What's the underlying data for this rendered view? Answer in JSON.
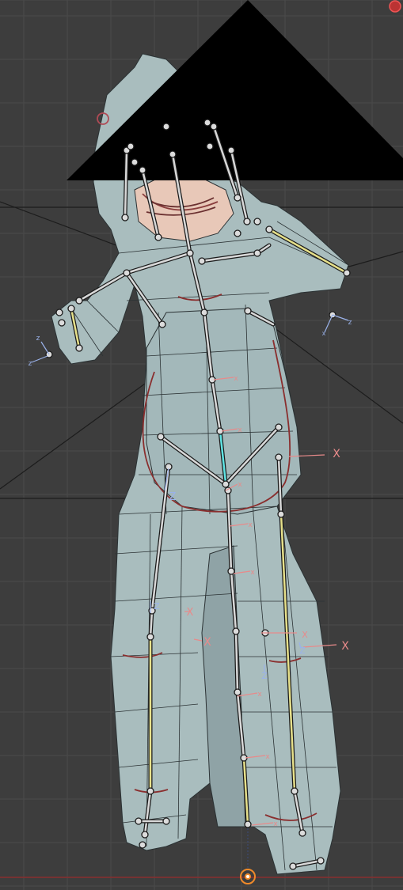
{
  "viewport": {
    "background": "#3d3d3d",
    "mesh_color": "#a9bdbe",
    "mesh_shadow": "#93a8ab",
    "wire_color": "#2b3234",
    "bone_color": "#d8d8d8",
    "bone_selected": "#e6e08a",
    "bone_active": "#5fe3e3",
    "x_axis_color": "#e88a8a",
    "y_axis_color": "#9fd29f",
    "z_axis_color": "#9ab2ea",
    "floor_line_color": "#8a2e2e",
    "origin_color": "#f08a2a",
    "camera_frustum_color": "#000000"
  },
  "axis_labels": {
    "x": "X",
    "z": "Z",
    "x_small": "x",
    "z_small": "z"
  },
  "icons": {
    "origin": "3d-cursor-icon",
    "gizmo": "navigation-gizmo-icon"
  }
}
